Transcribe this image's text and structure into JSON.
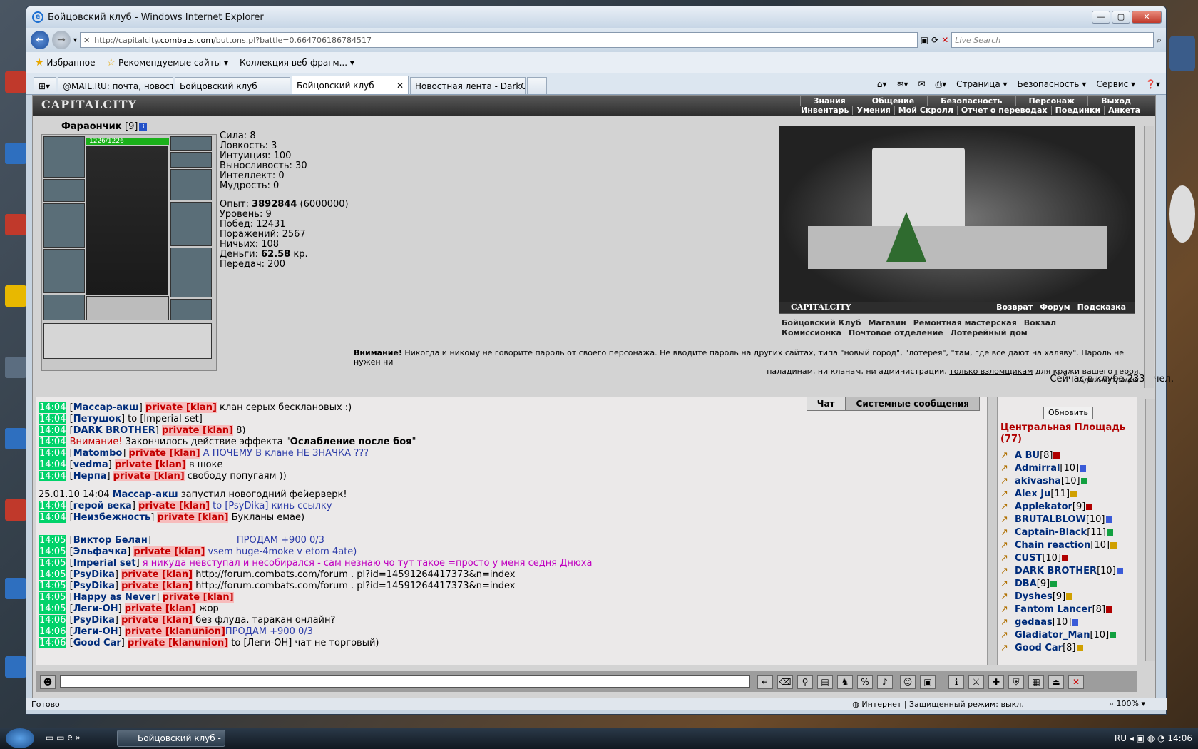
{
  "window": {
    "title": "Бойцовский клуб - Windows Internet Explorer"
  },
  "address": {
    "url_prefix": "http://capitalcity.",
    "url_domain": "combats.com",
    "url_rest": "/buttons.pl?battle=0.664706186784517",
    "search_placeholder": "Live Search"
  },
  "favorites": {
    "fav": "Избранное",
    "rec": "Рекомендуемые сайты ▾",
    "web": "Коллекция веб-фрагм... ▾"
  },
  "tabs": [
    "@MAIL.RU: почта, новост...",
    "Бойцовский клуб",
    "Бойцовский клуб",
    "Новостная лента - DarkCl..."
  ],
  "cmd": {
    "page": "Страница ▾",
    "security": "Безопасность ▾",
    "service": "Сервис ▾"
  },
  "site": {
    "logo": "CAPITALCITY",
    "nav1": [
      "Знания",
      "Общение",
      "Безопасность",
      "Персонаж",
      "Выход"
    ],
    "nav2": [
      "Инвентарь",
      "Умения",
      "Мой Скролл",
      "Отчет о переводах",
      "Поединки",
      "Анкета"
    ]
  },
  "character": {
    "name": "Фараончик",
    "level": "[9]",
    "hp": "1226/1226",
    "stats": [
      "Сила: 8",
      "Ловкость: 3",
      "Интуиция: 100",
      "Выносливость: 30",
      "Интеллект: 0",
      "Мудрость: 0"
    ],
    "exp_label": "Опыт: ",
    "exp": "3892844",
    "exp_max": " (6000000)",
    "level_line": "Уровень: 9",
    "wins": "Побед: 12431",
    "losses": "Поражений: 2567",
    "draws": "Ничьих: 108",
    "money_label": "Деньги: ",
    "money": "62.58",
    "money_unit": " кр.",
    "transfers": "Передач: 200"
  },
  "view": {
    "caption": "CAPITALCITY",
    "back": "Возврат",
    "forum": "Форум",
    "hint": "Подсказка"
  },
  "places": [
    "Бойцовский Клуб",
    "Магазин",
    "Ремонтная мастерская",
    "Вокзал",
    "Комиссионка",
    "Почтовое отделение",
    "Лотерейный дом"
  ],
  "warning": {
    "bold": "Внимание!",
    "text1": " Никогда и никому не говорите пароль от своего персонажа. Не вводите пароль на других сайтах, типа \"новый город\", \"лотерея\", \"там, где все дают на халяву\". Пароль не нужен ни",
    "text2": "паладинам, ни кланам, ни администрации, ",
    "link": "только взломщикам",
    "text3": " для кражи вашего героя.",
    "sign": "Администрация."
  },
  "online": "Сейчас в клубе 2330 чел.",
  "chat": {
    "tab_chat": "Чат",
    "tab_sys": "Системные сообщения",
    "private": "private [klan]",
    "private2": "private [klanunion]",
    "rows": [
      {
        "t": "14:04",
        "n": "Массар-акш",
        "p": true,
        "m": " клан серых бесклановых :)"
      },
      {
        "t": "14:04",
        "n": "Петушок",
        "p": false,
        "m": " to [Imperial set]"
      },
      {
        "t": "14:04",
        "n": "DARK BROTHER",
        "p": true,
        "m": " 8)"
      },
      {
        "t": "14:04",
        "sys1": "Внимание!",
        "sys2": " Закончилось действие эффекта \"",
        "sysb": "Ослабление после боя",
        "sys3": "\""
      },
      {
        "t": "14:04",
        "n": "Matombo",
        "p": true,
        "m": " А ПОЧЕМУ В клане НЕ ЗНАЧКА ???"
      },
      {
        "t": "14:04",
        "n": "vedma",
        "p": true,
        "m": " в шоке"
      },
      {
        "t": "14:04",
        "n": "Нерпа",
        "p": true,
        "m": " свободу попугаям ))"
      },
      {
        "d": "25.01.10 14:04",
        "n": "Массар-акш",
        "m": " запустил новогодний фейерверк!"
      },
      {
        "t": "14:04",
        "n": "герой века",
        "p": true,
        "m": " to [PsyDika] кинь ссылку"
      },
      {
        "t": "14:04",
        "n": "Неизбежность",
        "p": true,
        "m": " Букланы емае)"
      },
      {
        "t": "14:05",
        "n": "Виктор Белан",
        "m": "ПРОДАМ +900 0/3"
      },
      {
        "t": "14:05",
        "n": "Эльфачка",
        "p": true,
        "m": " vsem huge-4moke v etom 4ate)"
      },
      {
        "t": "14:05",
        "n": "Imperial set",
        "m": " я никуда невступал и несобирался - сам незнаю чо тут такое =просто у меня седня Днюха"
      },
      {
        "t": "14:05",
        "n": "PsyDika",
        "p": true,
        "m": " http://forum.combats.com/forum . pl?id=14591264417373&n=index"
      },
      {
        "t": "14:05",
        "n": "PsyDika",
        "p": true,
        "m": " http://forum.combats.com/forum . pl?id=14591264417373&n=index"
      },
      {
        "t": "14:05",
        "n": "Happy as Never",
        "p": true,
        "m": ""
      },
      {
        "t": "14:05",
        "n": "Леги-ОН",
        "p": true,
        "m": " жор"
      },
      {
        "t": "14:06",
        "n": "PsyDika",
        "p": true,
        "m": " без флуда. таракан онлайн?"
      },
      {
        "t": "14:06",
        "n": "Леги-ОН",
        "p2": true,
        "m": "ПРОДАМ +900 0/3"
      },
      {
        "t": "14:06",
        "n": "Good Car",
        "p2": true,
        "m": " to [Леги-ОН] чат не торговый)"
      }
    ]
  },
  "userlist": {
    "refresh": "Обновить",
    "room": "Центральная Площадь",
    "count": "(77)",
    "users": [
      {
        "n": "A BU",
        "l": "[8]"
      },
      {
        "n": "Admirral",
        "l": "[10]"
      },
      {
        "n": "akivasha",
        "l": "[10]"
      },
      {
        "n": "Alex Ju",
        "l": "[11]"
      },
      {
        "n": "Applekator",
        "l": "[9]"
      },
      {
        "n": "BRUTALBLOW",
        "l": "[10]"
      },
      {
        "n": "Captain-Black",
        "l": "[11]"
      },
      {
        "n": "Chain reaction",
        "l": "[10]"
      },
      {
        "n": "CUST",
        "l": "[10]"
      },
      {
        "n": "DARK BROTHER",
        "l": "[10]"
      },
      {
        "n": "DBA",
        "l": "[9]"
      },
      {
        "n": "Dyshes",
        "l": "[9]"
      },
      {
        "n": "Fantom Lancer",
        "l": "[8]"
      },
      {
        "n": "gedaas",
        "l": "[10]"
      },
      {
        "n": "Gladiator_Man",
        "l": "[10]"
      },
      {
        "n": "Good Car",
        "l": "[8]"
      }
    ]
  },
  "status": {
    "ready": "Готово",
    "zone": "Интернет | Защищенный режим: выкл.",
    "zoom": "100%"
  },
  "taskbar": {
    "task": "Бойцовский клуб - ...",
    "lang": "RU",
    "clock": "14:06"
  }
}
